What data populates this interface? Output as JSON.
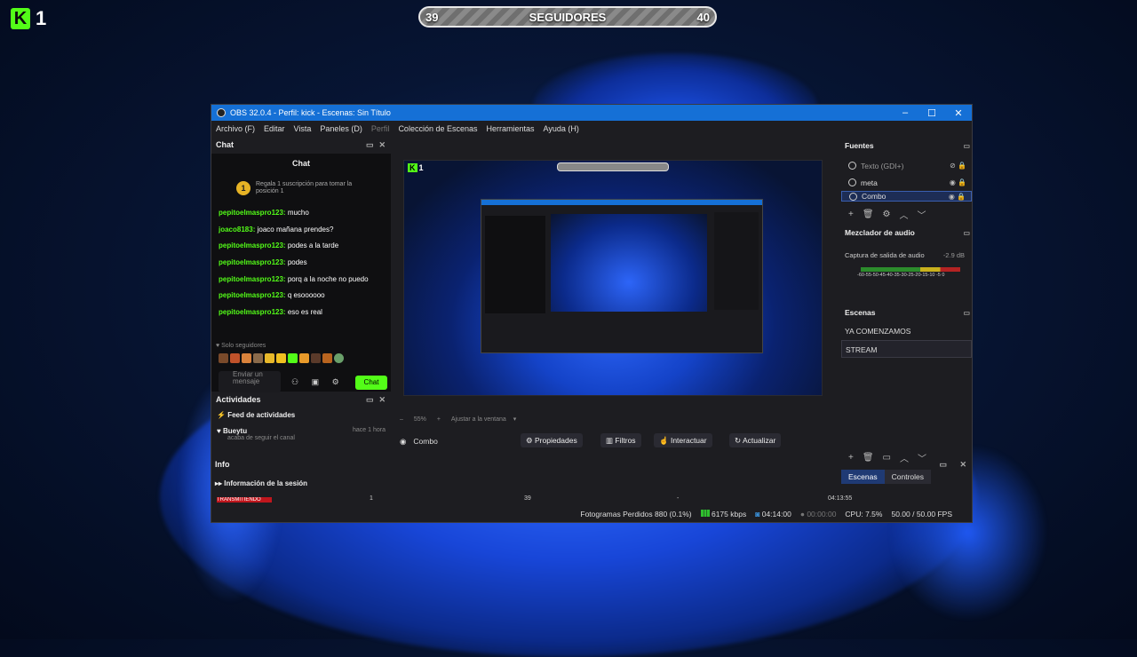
{
  "overlay": {
    "kick_count": "1",
    "follow_left": "39",
    "follow_label": "SEGUIDORES",
    "follow_right": "40"
  },
  "window": {
    "title": "OBS 32.0.4 - Perfil: kick - Escenas: Sin Título"
  },
  "menu": [
    "Archivo (F)",
    "Editar",
    "Vista",
    "Paneles (D)",
    "Perfil",
    "Colección de Escenas",
    "Herramientas",
    "Ayuda (H)"
  ],
  "chat": {
    "dock_title": "Chat",
    "panel_title": "Chat",
    "promo": "Regala 1 suscripción para tomar la posición 1",
    "messages": [
      {
        "user": "pepitoelmaspro123:",
        "text": "mucho"
      },
      {
        "user": "joaco8183:",
        "text": "joaco mañana prendes?"
      },
      {
        "user": "pepitoelmaspro123:",
        "text": "podes a la tarde"
      },
      {
        "user": "pepitoelmaspro123:",
        "text": "podes"
      },
      {
        "user": "pepitoelmaspro123:",
        "text": "porq a la noche no puedo"
      },
      {
        "user": "pepitoelmaspro123:",
        "text": "q esoooooo"
      },
      {
        "user": "pepitoelmaspro123:",
        "text": "eso es real"
      }
    ],
    "followers_only": "Solo seguidores",
    "input_placeholder": "Enviar un mensaje",
    "send_label": "Chat"
  },
  "activity": {
    "dock_title": "Actividades",
    "feed_label": "Feed de actividades",
    "item_user": "Bueytu",
    "item_text": "acaba de seguir el canal",
    "item_time": "hace 1 hora"
  },
  "info": {
    "dock_title": "Info",
    "section_label": "Información de la sesión",
    "live_label": "TRANSMITIENDO",
    "col1": "1",
    "col2": "39",
    "col3": "-",
    "col4": "04:13:55"
  },
  "preview": {
    "zoom": "55%",
    "fit_label": "Ajustar a la ventana",
    "overlay_count": "1",
    "overlay_label": "SEGUIDORES"
  },
  "source_bar": {
    "selected": "Combo",
    "properties": "Propiedades",
    "filters": "Filtros",
    "interact": "Interactuar",
    "refresh": "Actualizar"
  },
  "sources": {
    "title": "Fuentes",
    "items": [
      "Texto (GDI+)",
      "meta",
      "Combo"
    ]
  },
  "mixer": {
    "title": "Mezclador de audio",
    "channel": "Captura de salida de audio",
    "level": "-2.9 dB",
    "scale": "-60-55-50-45-40-35-30-25-20-15-10 -5 0"
  },
  "scenes": {
    "title": "Escenas",
    "items": [
      "YA COMENZAMOS",
      "STREAM"
    ],
    "selected": "STREAM"
  },
  "tabs": {
    "scenes": "Escenas",
    "controls": "Controles"
  },
  "status": {
    "dropped": "Fotogramas Perdidos 880 (0.1%)",
    "bitrate": "6175 kbps",
    "live_time": "04:14:00",
    "rec_time": "00:00:00",
    "cpu": "CPU: 7.5%",
    "fps": "50.00 / 50.00 FPS"
  },
  "colors": {
    "kick_green": "#53fc18",
    "titlebar_blue": "#1570d6",
    "live_red": "#c0161d",
    "accent_tab": "#1f3a74"
  }
}
